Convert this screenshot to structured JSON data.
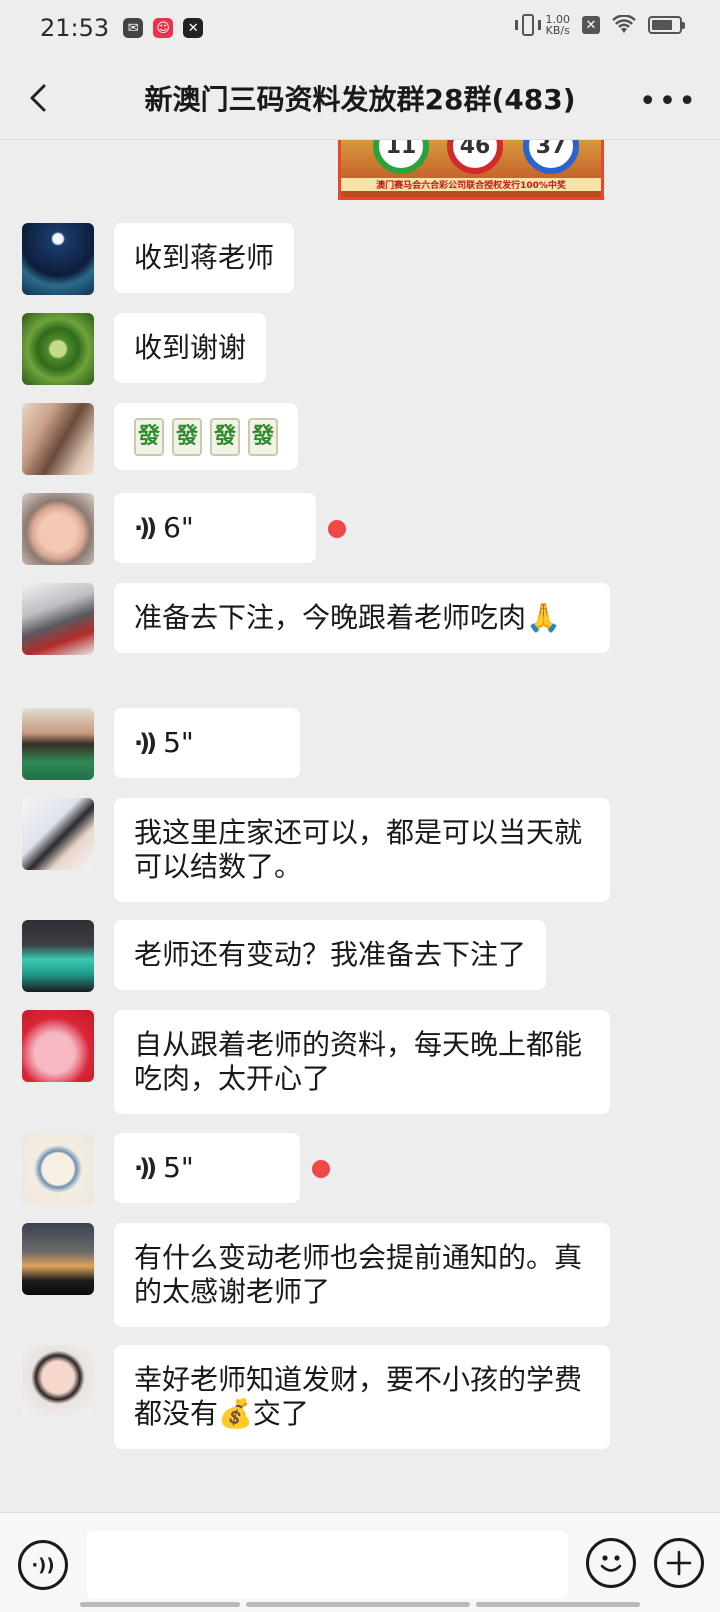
{
  "status_bar": {
    "time": "21:53",
    "net_speed_value": "1.00",
    "net_speed_unit": "KB/s"
  },
  "header": {
    "title": "新澳门三码资料发放群28群(483)"
  },
  "lottery_image": {
    "numbers": [
      "11",
      "46",
      "37"
    ],
    "caption": "澳门赛马会六合彩公司联合授权发行100%中奖"
  },
  "messages": [
    {
      "type": "text",
      "text": "收到蒋老师"
    },
    {
      "type": "text",
      "text": "收到谢谢"
    },
    {
      "type": "sticker",
      "tiles": [
        "發",
        "發",
        "發",
        "發"
      ]
    },
    {
      "type": "voice",
      "duration": "6\"",
      "unread": true
    },
    {
      "type": "text",
      "text": "准备去下注，今晚跟着老师吃肉🙏"
    },
    {
      "type": "voice",
      "duration": "5\"",
      "unread": false
    },
    {
      "type": "text",
      "text": "我这里庄家还可以，都是可以当天就可以结数了。"
    },
    {
      "type": "text",
      "text": "老师还有变动？我准备去下注了"
    },
    {
      "type": "text",
      "text": "自从跟着老师的资料，每天晚上都能吃肉，太开心了"
    },
    {
      "type": "voice",
      "duration": "5\"",
      "unread": true
    },
    {
      "type": "text",
      "text": "有什么变动老师也会提前通知的。真的太感谢老师了"
    },
    {
      "type": "text",
      "text": "幸好老师知道发财，要不小孩的学费都没有💰交了"
    }
  ],
  "colors": {
    "background": "#ededed",
    "bubble": "#ffffff",
    "unread_dot": "#f0484a"
  }
}
